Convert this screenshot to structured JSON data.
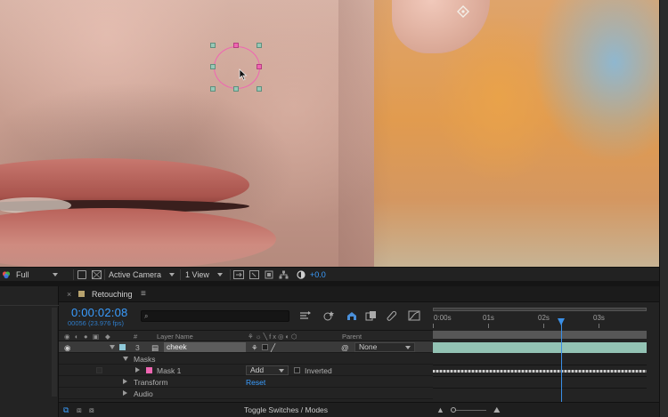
{
  "viewer_toolbar": {
    "resolution": "Full",
    "camera": "Active Camera",
    "views": "1 View",
    "exposure": "+0.0"
  },
  "timeline": {
    "tab_label": "Retouching",
    "timecode": "0:00:02:08",
    "frame_info": "00056 (23.976 fps)",
    "search_placeholder": "",
    "columns": {
      "number": "#",
      "layer_name": "Layer Name",
      "parent": "Parent"
    },
    "layer": {
      "number": "3",
      "name": "cheek",
      "parent": "None",
      "label_color": "#8fc9d9"
    },
    "masks_group": "Masks",
    "mask": {
      "name": "Mask 1",
      "color": "#ef66b2",
      "mode": "Add",
      "inverted_label": "Inverted"
    },
    "transform": {
      "label": "Transform",
      "reset": "Reset"
    },
    "audio_label": "Audio",
    "toggle_label": "Toggle Switches / Modes",
    "ruler": [
      "0:00s",
      "01s",
      "02s",
      "03s"
    ],
    "playhead_fraction": 0.6
  },
  "colors": {
    "accent_blue": "#3a9dff",
    "layer_bar": "#93c3b4",
    "mask_pink": "#ef66b2",
    "tab_swatch": "#b8a36e"
  }
}
